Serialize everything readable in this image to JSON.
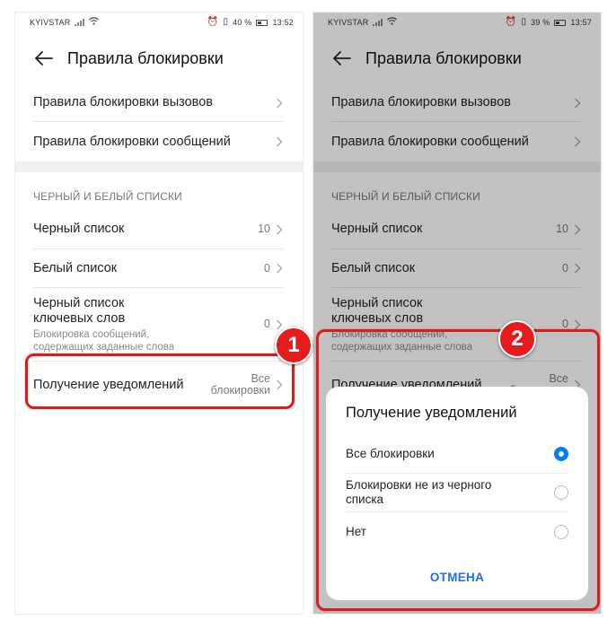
{
  "status": {
    "carrier": "KYIVSTAR",
    "left_battery": "40 %",
    "left_time": "13:52",
    "right_battery": "39 %",
    "right_time": "13:57"
  },
  "screen": {
    "title": "Правила блокировки",
    "call_rules": "Правила блокировки вызовов",
    "message_rules": "Правила блокировки сообщений",
    "section_header": "ЧЕРНЫЙ И БЕЛЫЙ СПИСКИ",
    "blacklist": {
      "label": "Черный список",
      "value": "10"
    },
    "whitelist": {
      "label": "Белый список",
      "value": "0"
    },
    "keywords": {
      "label_line1": "Черный список",
      "label_line2": "ключевых слов",
      "sub_line1": "Блокировка сообщений,",
      "sub_line2": "содержащих заданные слова",
      "value": "0"
    },
    "notifications": {
      "label": "Получение уведомлений",
      "value_line1": "Все",
      "value_line2": "блокировки"
    }
  },
  "dialog": {
    "title": "Получение уведомлений",
    "options": [
      {
        "line1": "Все блокировки",
        "line2": "",
        "selected": true
      },
      {
        "line1": "Блокировки не из черного",
        "line2": "списка",
        "selected": false
      },
      {
        "line1": "Нет",
        "line2": "",
        "selected": false
      }
    ],
    "cancel": "ОТМЕНА"
  },
  "annotations": {
    "step1": "1",
    "step2": "2"
  },
  "colors": {
    "highlight": "#d91c1c",
    "accent": "#007dff",
    "cancel": "#1f6feb",
    "badge": "#e51c1c"
  }
}
